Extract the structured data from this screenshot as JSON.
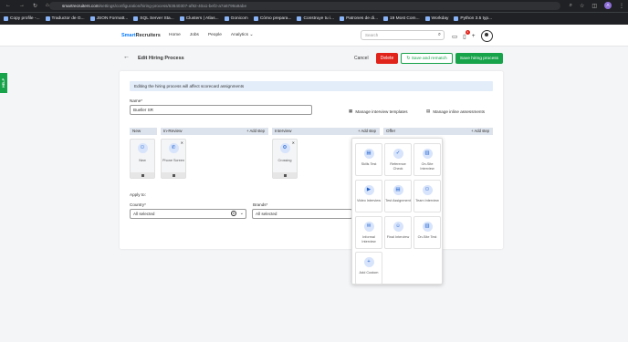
{
  "browser": {
    "url_host": "smartrecruiters.com",
    "url_path": "/settings/configuration/hiring-process/63640307-af92-40a1-bef2-a7a6799a9abe",
    "profile_initial": "A",
    "bookmarks": [
      "Copy profile -...",
      "Traductor de G...",
      "JSON Formatt...",
      "SQL Server Sta...",
      "Clusters | Atlas...",
      "Gonicom",
      "Cómo prepara...",
      "Construye tu i...",
      "Patrones de di...",
      "19 Most Com...",
      "Workday",
      "Python 3.5 typ..."
    ]
  },
  "header": {
    "logo_part1": "Smart",
    "logo_part2": "Recruiters",
    "nav": [
      "Home",
      "Jobs",
      "People",
      "Analytics"
    ],
    "search_placeholder": "Search",
    "notification_count": "1"
  },
  "help_label": "HELP",
  "page": {
    "title": "Edit Hiring Process",
    "cancel_label": "Cancel",
    "delete_label": "Delete",
    "rematch_label": "Save and rematch",
    "save_label": "Save hiring process"
  },
  "form": {
    "banner": "Editing the hiring process will affect scorecard assignments",
    "name_label": "Name*",
    "name_value": "Bueller SR",
    "manage_templates": "Manage interview templates",
    "manage_assessments": "Manage inline assessments",
    "apply_to": "Apply to:",
    "country_label": "Country*",
    "country_value": "All selected",
    "brands_label": "Brands*",
    "brands_value": "All selected"
  },
  "stages": [
    {
      "name": "New",
      "add_step": ""
    },
    {
      "name": "In-Review",
      "add_step": "Add step"
    },
    {
      "name": "Interview",
      "add_step": "Add step"
    },
    {
      "name": "Offer",
      "add_step": "Add step"
    }
  ],
  "tiles": [
    {
      "label": "New",
      "icon": "person-add-icon"
    },
    {
      "label": "Phone Screen",
      "icon": "phone-icon"
    },
    {
      "label": "Crossing",
      "icon": "gear-icon"
    }
  ],
  "step_options": [
    {
      "label": "Skills Test",
      "icon": "clipboard-icon"
    },
    {
      "label": "Reference Check",
      "icon": "check-circle-icon"
    },
    {
      "label": "On-Site Interview",
      "icon": "building-icon"
    },
    {
      "label": "Video Interview",
      "icon": "video-icon"
    },
    {
      "label": "Test Assignment",
      "icon": "clipboard-icon"
    },
    {
      "label": "Team Interview",
      "icon": "group-icon"
    },
    {
      "label": "Informal Interview",
      "icon": "chat-icon"
    },
    {
      "label": "Final Interview",
      "icon": "person-icon"
    },
    {
      "label": "On-Site Test",
      "icon": "building-icon"
    },
    {
      "label": "Add Custom",
      "icon": "plus-icon"
    }
  ]
}
